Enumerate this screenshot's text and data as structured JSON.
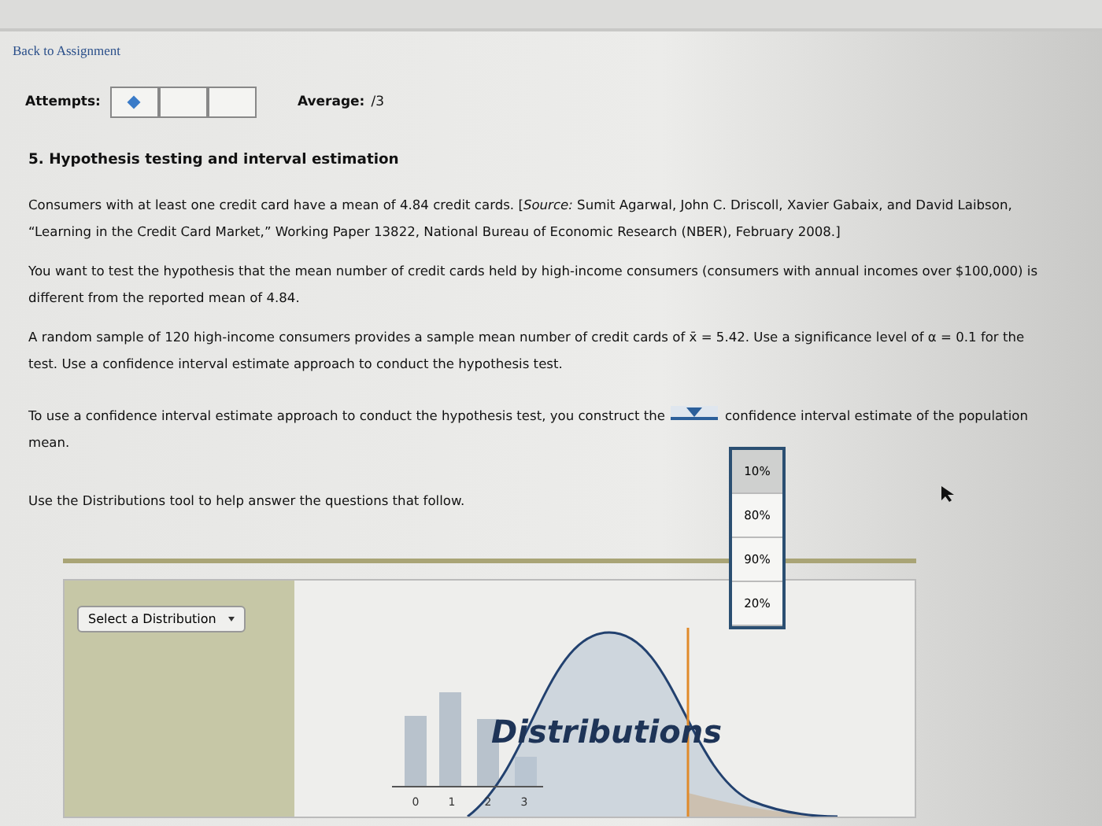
{
  "back_link": "Back to Assignment",
  "attempts": {
    "label": "Attempts:",
    "boxes": [
      {
        "filled": true
      },
      {
        "filled": false
      },
      {
        "filled": false
      }
    ]
  },
  "average": {
    "label": "Average:",
    "value": "/3"
  },
  "question": {
    "title": "5. Hypothesis testing and interval estimation",
    "paragraphs": [
      "Consumers with at least one credit card have a mean of 4.84 credit cards. [*Source:* Sumit Agarwal, John C. Driscoll, Xavier Gabaix, and David Laibson, “Learning in the Credit Card Market,” Working Paper 13822, National Bureau of Economic Research (NBER), February 2008.]",
      "You want to test the hypothesis that the mean number of credit cards held by high-income consumers (consumers with annual incomes over $100,000) is different from the reported mean of 4.84.",
      "A random sample of 120 high-income consumers provides a sample mean number of credit cards of x̄ = 5.42. Use a significance level of α = 0.1 for the test. Use a confidence interval estimate approach to conduct the hypothesis test."
    ],
    "sentence_before": "To use a confidence interval estimate approach to conduct the hypothesis test, you construct the",
    "sentence_after": "confidence interval estimate of the population",
    "sentence_end": "mean.",
    "dropdown": {
      "expanded": true,
      "options": [
        {
          "label": "10%",
          "selected": true
        },
        {
          "label": "80%",
          "selected": false
        },
        {
          "label": "90%",
          "selected": false
        },
        {
          "label": "20%",
          "selected": false
        }
      ]
    },
    "instruction": "Use the Distributions tool to help answer the questions that follow."
  },
  "tool": {
    "button": "Select a Distribution",
    "logo_text": "Distributions",
    "axis_labels": [
      "0",
      "1",
      "2",
      "3"
    ]
  }
}
